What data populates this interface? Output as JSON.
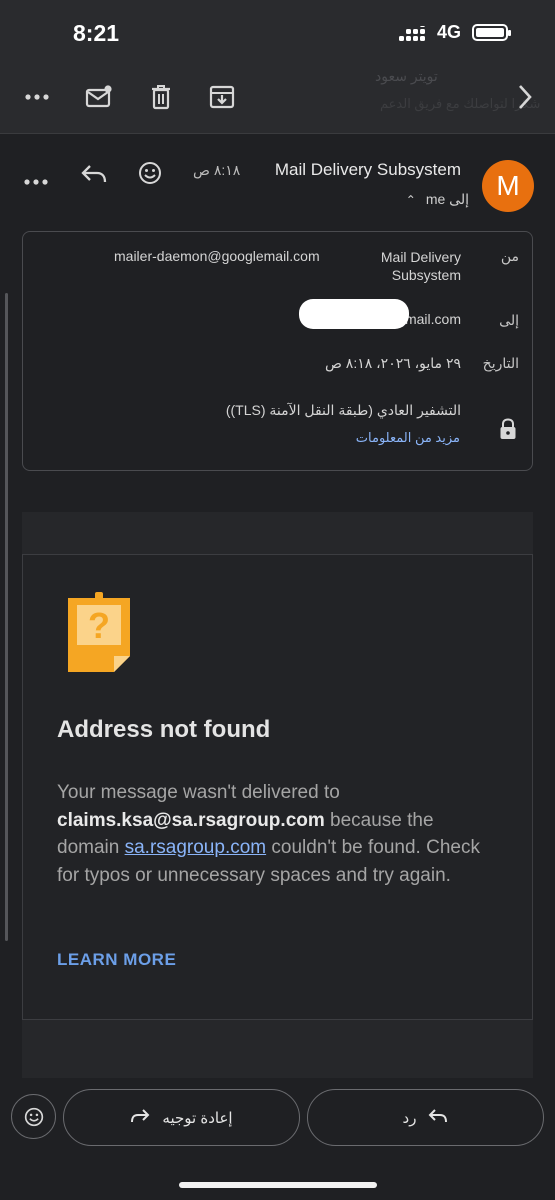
{
  "status_bar": {
    "time": "8:21",
    "network": "4G"
  },
  "toolbar": {
    "icons": [
      "more-icon",
      "mark-unread-icon",
      "delete-icon",
      "archive-icon",
      "chevron-right-icon"
    ],
    "ghost_line1": "تويتر سعود",
    "ghost_line2": "شكرا لتواصلك مع فريق الدعم"
  },
  "message": {
    "avatar_letter": "M",
    "sender_name": "Mail Delivery Subsystem",
    "time": "٨:١٨ ص",
    "to_label": "إلى me"
  },
  "details": {
    "from_label": "من",
    "from_name": "Mail Delivery Subsystem",
    "from_email": "mailer-daemon@googlemail.com",
    "to_label": "إلى",
    "to_value": "@gmail.com",
    "date_label": "التاريخ",
    "date_value": "٢٩ مايو، ٢٠٢٦، ٨:١٨ ص",
    "encryption": "التشفير العادي (طبقة النقل الآمنة (TLS))",
    "more_info": "مزيد من المعلومات"
  },
  "bounce": {
    "title": "Address not found",
    "text_1": "Your message wasn't delivered to",
    "address": "claims.ksa@sa.rsagroup.com",
    "text_2": " because the domain ",
    "domain": "sa.rsagroup.com",
    "text_3": " couldn't be found. Check for typos or unnecessary spaces and try again.",
    "learn_more": "LEARN MORE",
    "note_glyph": "?"
  },
  "bottom_bar": {
    "forward_label": "إعادة توجيه",
    "reply_label": "رد"
  },
  "colors": {
    "background": "#1f2023",
    "accent_link": "#8ab4f8",
    "avatar": "#e8700f",
    "note_icon": "#f5a623"
  }
}
